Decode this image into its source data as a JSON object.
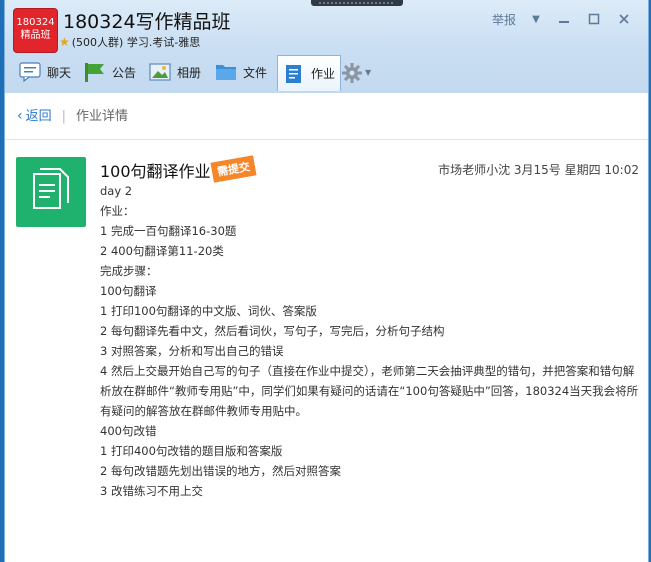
{
  "window": {
    "group_avatar": {
      "line1": "180324",
      "line2": "精品班"
    },
    "group_name": "180324写作精品班",
    "group_sub": "(500人群) 学习.考试-雅思",
    "controls": {
      "report": "举报",
      "dropdown": "▼",
      "minimize": "▭",
      "maximize": "☐",
      "close": "✕"
    }
  },
  "toolbar": {
    "items": [
      {
        "label": "聊天",
        "icon": "chat-icon"
      },
      {
        "label": "公告",
        "icon": "announcement-icon"
      },
      {
        "label": "相册",
        "icon": "album-icon"
      },
      {
        "label": "文件",
        "icon": "folder-icon"
      },
      {
        "label": "作业",
        "icon": "homework-icon",
        "active": true
      }
    ],
    "settings_icon": "gear-icon"
  },
  "breadcrumb": {
    "back": "返回",
    "current": "作业详情"
  },
  "homework": {
    "title": "100句翻译作业",
    "badge": "需提交",
    "meta": "市场老师小沈 3月15号 星期四 10:02",
    "lines": [
      "day 2",
      "作业：",
      "1 完成一百句翻译16-30题",
      "2 400句翻译第11-20类",
      "完成步骤：",
      "100句翻译",
      "1 打印100句翻译的中文版、词伙、答案版",
      "2 每句翻译先看中文，然后看词伙，写句子，写完后，分析句子结构",
      "3 对照答案，分析和写出自己的错误",
      "4 然后上交最开始自己写的句子（直接在作业中提交），老师第二天会抽评典型的错句，并把答案和错句解析放在群邮件“教师专用贴”中，同学们如果有疑问的话请在“100句答疑贴中”回答，180324当天我会将所有疑问的解答放在群邮件教师专用贴中。",
      "400句改错",
      "1 打印400句改错的题目版和答案版",
      "2 每句改错题先划出错误的地方，然后对照答案",
      "3 改错练习不用上交"
    ]
  },
  "colors": {
    "accent": "#2a78c9",
    "badge": "#f6862a",
    "doc_icon": "#1fb26e",
    "avatar": "#e2242b"
  }
}
